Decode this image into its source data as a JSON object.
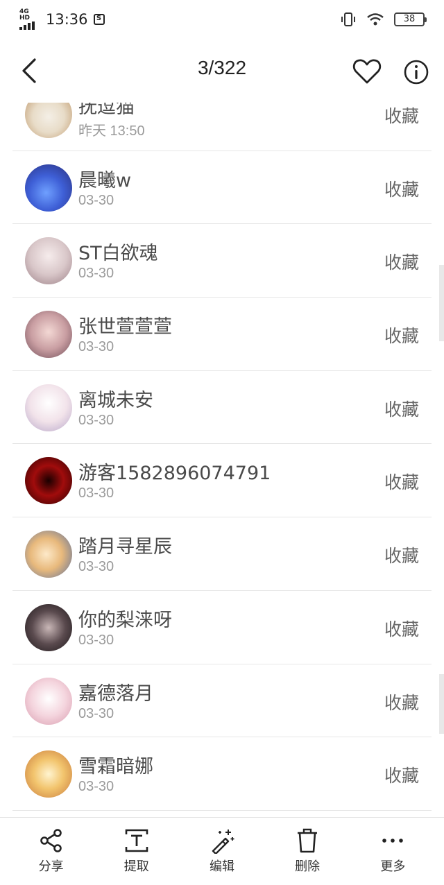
{
  "status_bar": {
    "network": "4G HD",
    "time": "13:36",
    "battery": "38"
  },
  "header": {
    "page_counter": "3/322"
  },
  "list": {
    "action_label": "收藏",
    "items": [
      {
        "name": "抚逗猫",
        "date": "昨天 13:50"
      },
      {
        "name": "晨曦w",
        "date": "03-30"
      },
      {
        "name": "ST白欲魂",
        "date": "03-30"
      },
      {
        "name": "张世萱萱萱",
        "date": "03-30"
      },
      {
        "name": "离城未安",
        "date": "03-30"
      },
      {
        "name": "游客1582896074791",
        "date": "03-30"
      },
      {
        "name": "踏月寻星辰",
        "date": "03-30"
      },
      {
        "name": "你的梨涞呀",
        "date": "03-30"
      },
      {
        "name": "嘉德落月",
        "date": "03-30"
      },
      {
        "name": "雪霜暗娜",
        "date": "03-30"
      }
    ]
  },
  "toolbar": {
    "share": "分享",
    "extract": "提取",
    "edit": "编辑",
    "delete": "删除",
    "more": "更多"
  },
  "icons": {
    "back": "chevron-left-icon",
    "favorite": "heart-icon",
    "info": "info-icon",
    "share": "share-icon",
    "extract": "text-extract-icon",
    "edit": "magic-wand-icon",
    "delete": "trash-icon",
    "more": "more-dots-icon"
  }
}
